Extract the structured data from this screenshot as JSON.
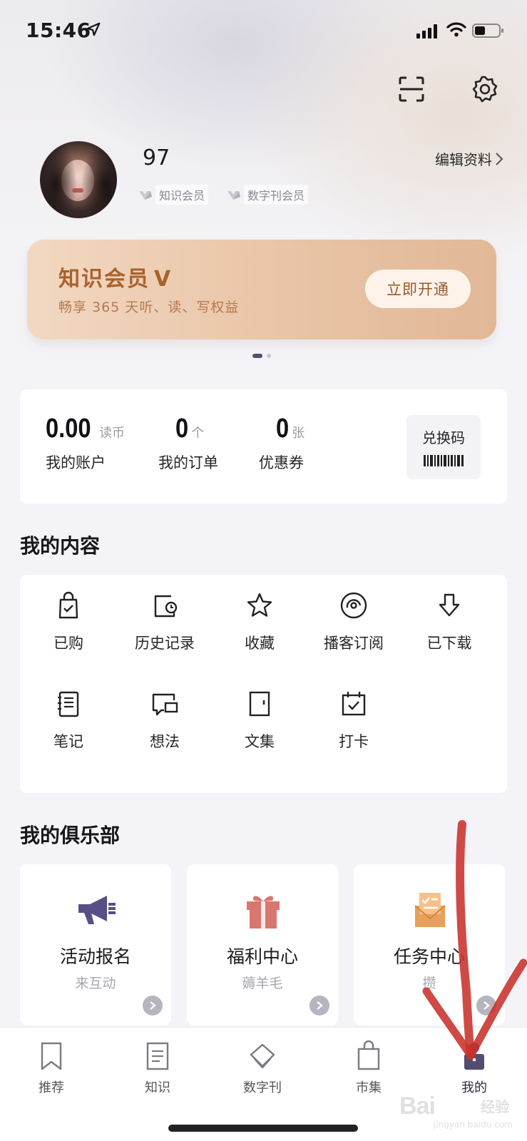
{
  "status_bar": {
    "time": "15:46"
  },
  "profile": {
    "username": "97",
    "badges": [
      "知识会员",
      "数字刊会员"
    ],
    "edit_label": "编辑资料"
  },
  "member_banner": {
    "title": "知识会员",
    "title_mark": "V",
    "subtitle": "畅享 365 天听、读、写权益",
    "button": "立即开通",
    "page_count": 2,
    "active_page": 1
  },
  "account": {
    "balance": {
      "value": "0.00",
      "unit": "读币",
      "label": "我的账户"
    },
    "orders": {
      "value": "0",
      "unit": "个",
      "label": "我的订单"
    },
    "coupons": {
      "value": "0",
      "unit": "张",
      "label": "优惠券"
    },
    "redeem_label": "兑换码"
  },
  "my_content": {
    "title": "我的内容",
    "items": [
      {
        "label": "已购",
        "icon": "shopping-bag-icon"
      },
      {
        "label": "历史记录",
        "icon": "history-icon"
      },
      {
        "label": "收藏",
        "icon": "star-icon"
      },
      {
        "label": "播客订阅",
        "icon": "podcast-icon"
      },
      {
        "label": "已下载",
        "icon": "download-icon"
      },
      {
        "label": "笔记",
        "icon": "notebook-icon"
      },
      {
        "label": "想法",
        "icon": "chat-icon"
      },
      {
        "label": "文集",
        "icon": "collection-icon"
      },
      {
        "label": "打卡",
        "icon": "calendar-check-icon"
      }
    ]
  },
  "my_club": {
    "title": "我的俱乐部",
    "cards": [
      {
        "title": "活动报名",
        "subtitle": "来互动",
        "icon": "megaphone-icon",
        "color": "#574f85"
      },
      {
        "title": "福利中心",
        "subtitle": "薅羊毛",
        "icon": "gift-icon",
        "color": "#d9766f"
      },
      {
        "title": "任务中心",
        "subtitle": "攒",
        "icon": "task-icon",
        "color": "#e8a05a"
      }
    ]
  },
  "tab_bar": {
    "tabs": [
      {
        "label": "推荐",
        "icon": "bookmark-icon"
      },
      {
        "label": "知识",
        "icon": "document-icon"
      },
      {
        "label": "数字刊",
        "icon": "magazine-icon"
      },
      {
        "label": "市集",
        "icon": "bag-icon"
      },
      {
        "label": "我的",
        "icon": "profile-icon"
      }
    ],
    "active": "我的"
  },
  "watermark": {
    "brand": "Bai",
    "brand_suffix": "经验",
    "domain": "jingyan.baidu.com"
  },
  "colors": {
    "accent": "#544d72",
    "banner_gold": "#a9622c",
    "annotation_red": "#c8312a"
  }
}
